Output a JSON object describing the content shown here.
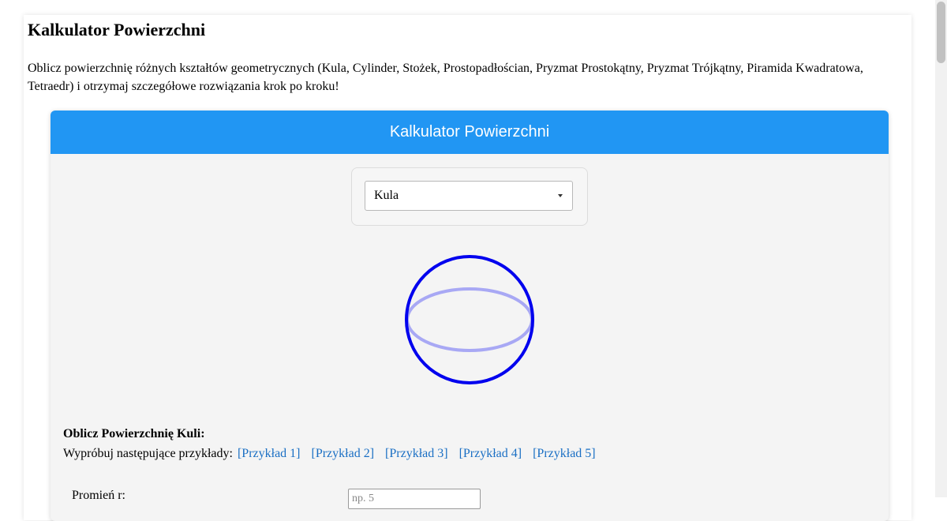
{
  "page": {
    "title": "Kalkulator Powierzchni",
    "intro": "Oblicz powierzchnię różnych kształtów geometrycznych (Kula, Cylinder, Stożek, Prostopadłościan, Pryzmat Prostokątny, Pryzmat Trójkątny, Piramida Kwadratowa, Tetraedr) i otrzymaj szczegółowe rozwiązania krok po kroku!"
  },
  "calculator": {
    "header": "Kalkulator Powierzchni",
    "shape_select": {
      "selected": "Kula"
    },
    "sphere_colors": {
      "outline": "#0000ee",
      "equator": "#a8a8f4"
    },
    "heading": "Oblicz Powierzchnię Kuli:",
    "examples_label": "Wypróbuj następujące przykłady:",
    "examples": [
      "[Przykład 1]",
      "[Przykład 2]",
      "[Przykład 3]",
      "[Przykład 4]",
      "[Przykład 5]"
    ],
    "radius_label": "Promień r:",
    "radius_placeholder": "np. 5"
  },
  "colors": {
    "header_bg": "#2196f3",
    "link": "#1a6fc4"
  }
}
